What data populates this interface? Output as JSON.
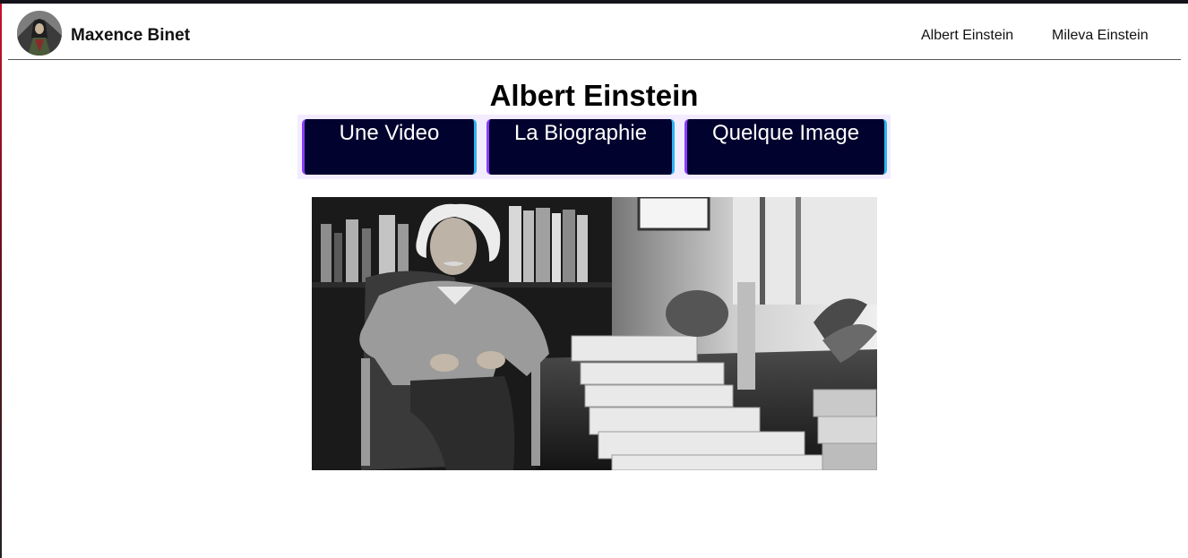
{
  "navbar": {
    "brand_name": "Maxence Binet",
    "avatar_icon": "profile-avatar-icon",
    "links": [
      {
        "label": "Albert Einstein"
      },
      {
        "label": "Mileva Einstein"
      }
    ]
  },
  "main": {
    "title": "Albert Einstein",
    "tabs": [
      {
        "label": "Une Video"
      },
      {
        "label": "La Biographie"
      },
      {
        "label": "Quelque Image"
      }
    ],
    "photo_icon": "einstein-photo"
  },
  "colors": {
    "tab_background": "#02022e",
    "tab_border_left": "#8b3dff",
    "tab_border_right": "#2fb3f2",
    "tabs_strip_background": "#f3ecff",
    "top_strip": "#14121a"
  }
}
